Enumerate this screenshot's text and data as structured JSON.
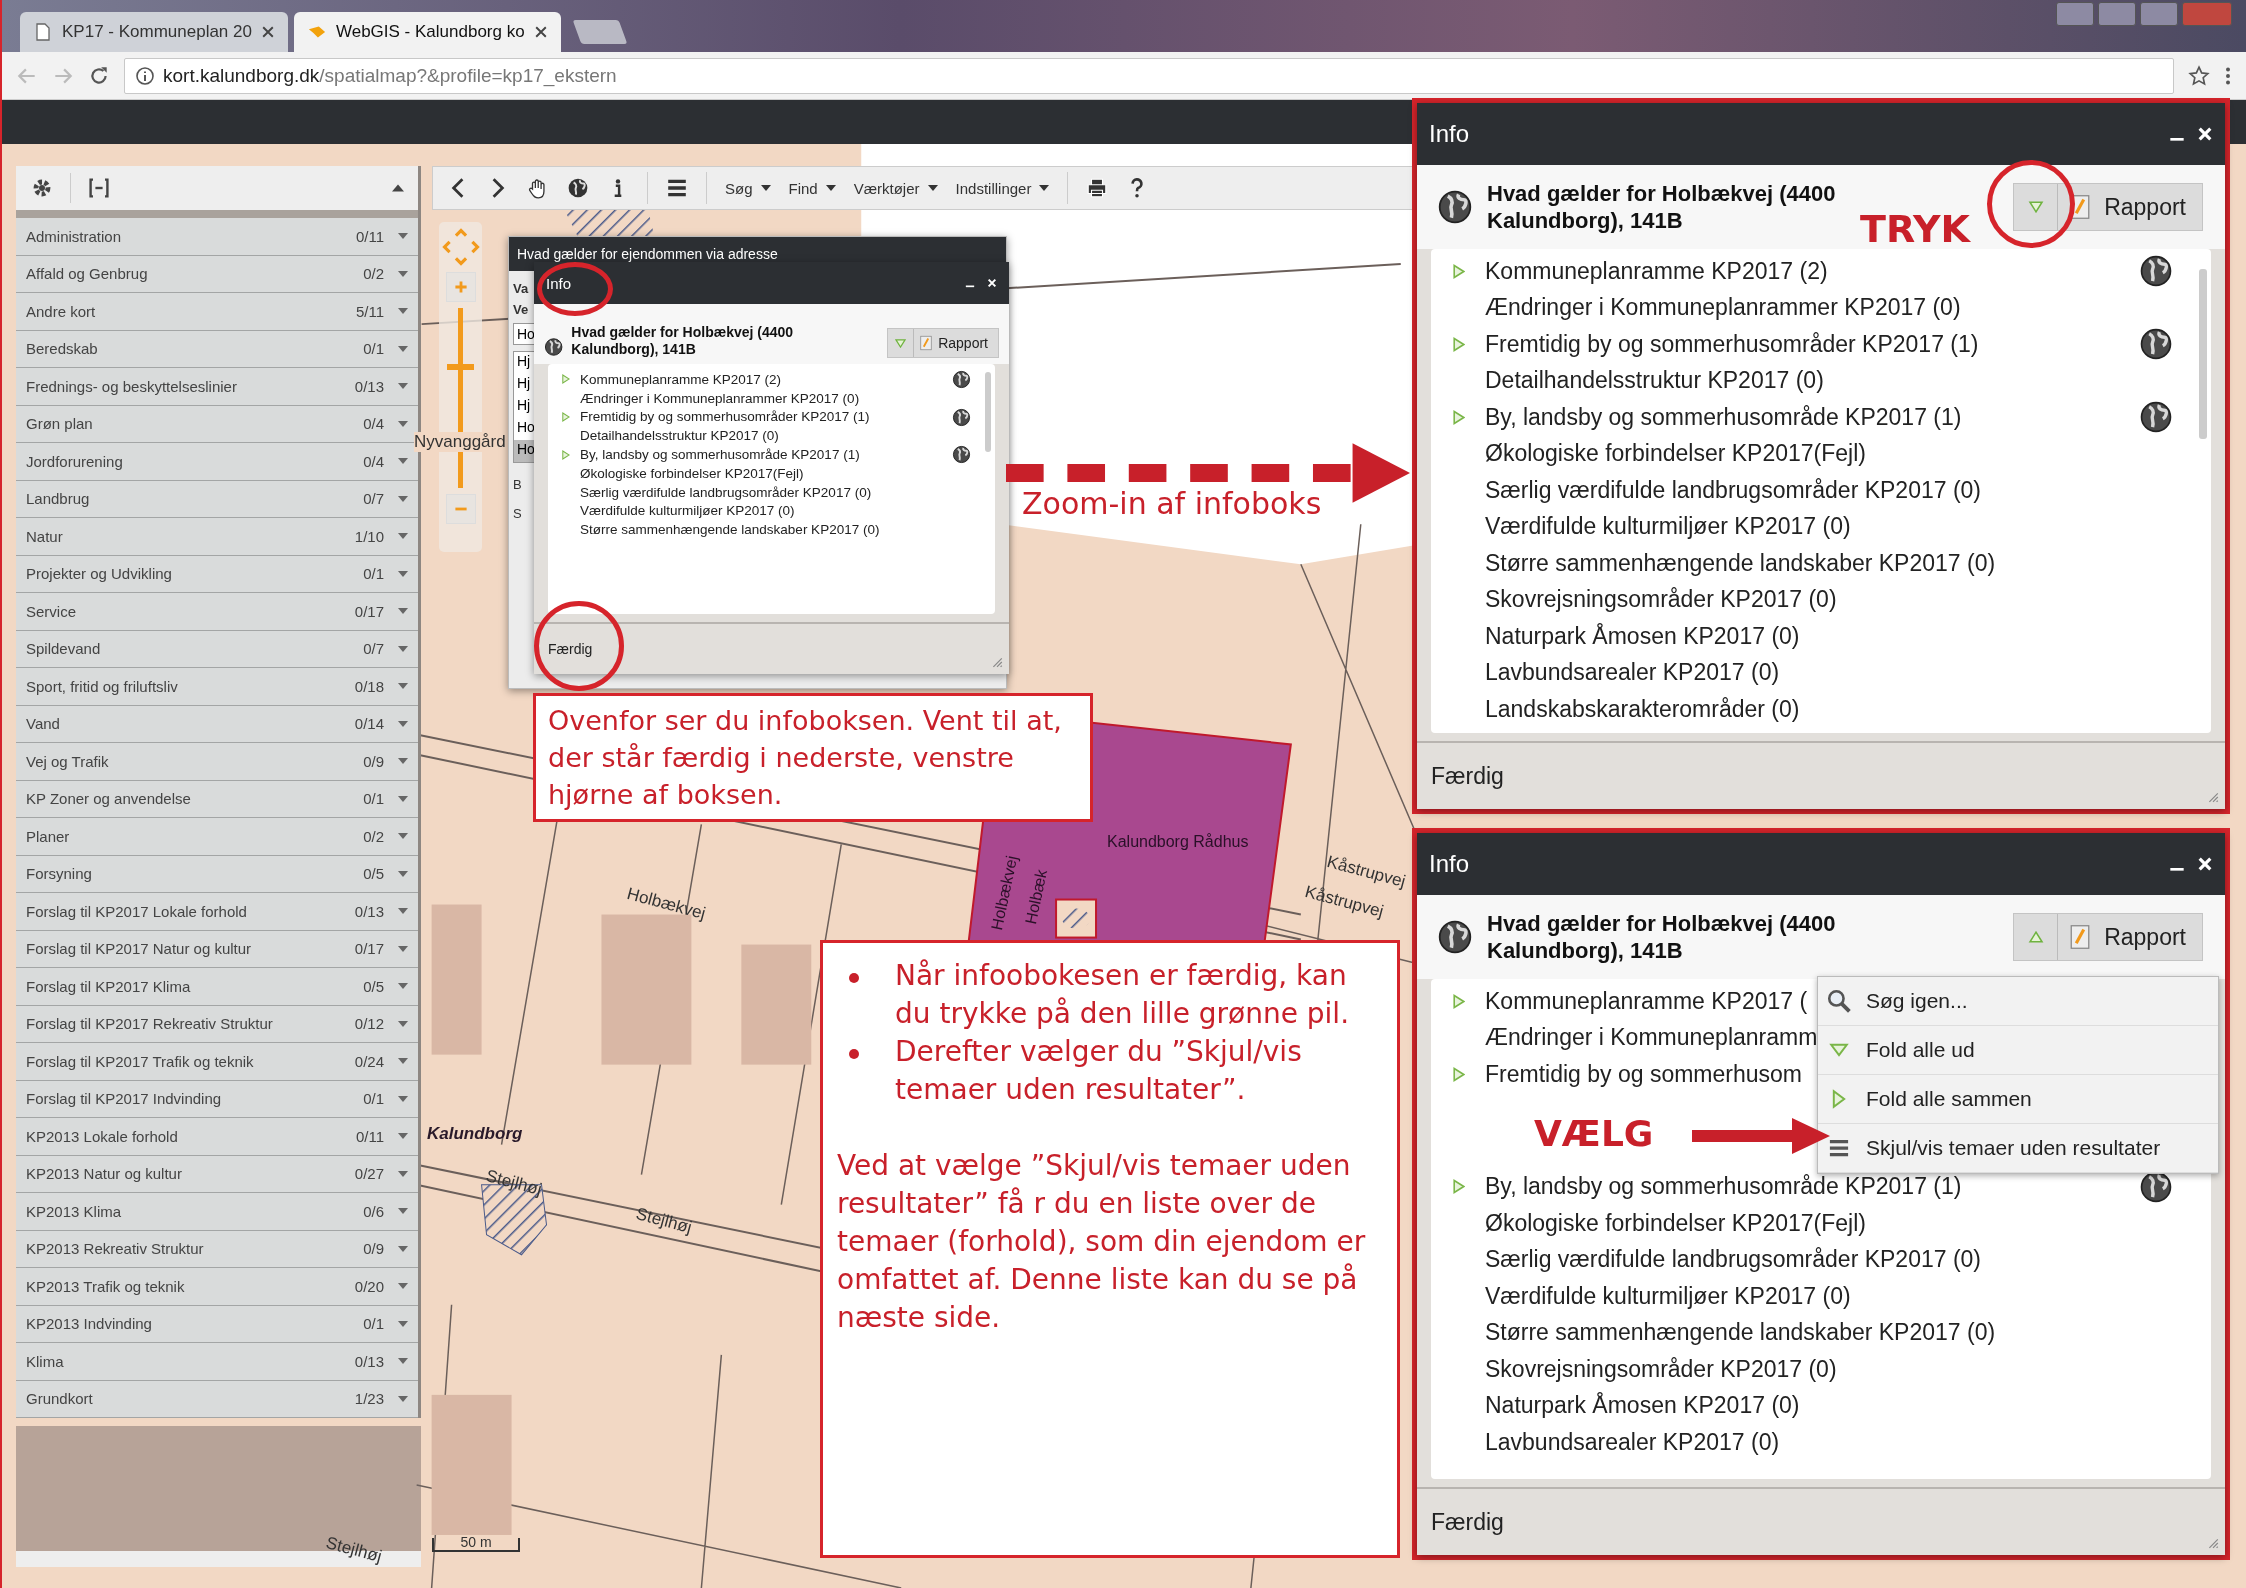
{
  "browser": {
    "tabs": [
      {
        "title": "KP17 - Kommuneplan 20",
        "selected": false,
        "kind": "document"
      },
      {
        "title": "WebGIS - Kalundborg ko",
        "selected": true,
        "kind": "webgis"
      }
    ],
    "url_host": "kort.kalundborg.dk",
    "url_path": "/spatialmap?&profile=kp17_ekstern"
  },
  "layers_panel": {
    "items": [
      {
        "name": "Administration",
        "count": "0/11"
      },
      {
        "name": "Affald og Genbrug",
        "count": "0/2"
      },
      {
        "name": "Andre kort",
        "count": "5/11"
      },
      {
        "name": "Beredskab",
        "count": "0/1"
      },
      {
        "name": "Frednings- og beskyttelseslinier",
        "count": "0/13"
      },
      {
        "name": "Grøn plan",
        "count": "0/4"
      },
      {
        "name": "Jordforurening",
        "count": "0/4"
      },
      {
        "name": "Landbrug",
        "count": "0/7"
      },
      {
        "name": "Natur",
        "count": "1/10"
      },
      {
        "name": "Projekter og Udvikling",
        "count": "0/1"
      },
      {
        "name": "Service",
        "count": "0/17"
      },
      {
        "name": "Spildevand",
        "count": "0/7"
      },
      {
        "name": "Sport, fritid og friluftsliv",
        "count": "0/18"
      },
      {
        "name": "Vand",
        "count": "0/14"
      },
      {
        "name": "Vej og Trafik",
        "count": "0/9"
      },
      {
        "name": "KP Zoner og anvendelse",
        "count": "0/1"
      },
      {
        "name": "Planer",
        "count": "0/2"
      },
      {
        "name": "Forsyning",
        "count": "0/5"
      },
      {
        "name": "Forslag til KP2017 Lokale forhold",
        "count": "0/13"
      },
      {
        "name": "Forslag til KP2017 Natur og kultur",
        "count": "0/17"
      },
      {
        "name": "Forslag til KP2017 Klima",
        "count": "0/5"
      },
      {
        "name": "Forslag til KP2017 Rekreativ Struktur",
        "count": "0/12"
      },
      {
        "name": "Forslag til KP2017 Trafik og teknik",
        "count": "0/24"
      },
      {
        "name": "Forslag til KP2017 Indvinding",
        "count": "0/1"
      },
      {
        "name": "KP2013 Lokale forhold",
        "count": "0/11"
      },
      {
        "name": "KP2013 Natur og kultur",
        "count": "0/27"
      },
      {
        "name": "KP2013 Klima",
        "count": "0/6"
      },
      {
        "name": "KP2013 Rekreativ Struktur",
        "count": "0/9"
      },
      {
        "name": "KP2013 Trafik og teknik",
        "count": "0/20"
      },
      {
        "name": "KP2013 Indvinding",
        "count": "0/1"
      },
      {
        "name": "Klima",
        "count": "0/13"
      },
      {
        "name": "Grundkort",
        "count": "1/23"
      }
    ]
  },
  "map_toolbar": {
    "menus": [
      "Søg",
      "Find",
      "Værktøjer",
      "Indstillinger"
    ]
  },
  "map_labels": [
    "Nyvanggård",
    "Kalundborg Rådhus",
    "Holbækvej",
    "Holbækvej",
    "Holbæk",
    "Kåstrupvej",
    "Kåstrupvej",
    "Kalundborg",
    "Stejlhøj",
    "Stejlhøj",
    "Stejlhøj"
  ],
  "scale_bar": "50 m",
  "zoom_slider": {
    "level": 0.68
  },
  "address_dialog": {
    "title": "Hvad gælder for ejendommen via adresse",
    "labels": [
      "Va",
      "Ve"
    ],
    "input_value": "Ho",
    "list": [
      {
        "text": "Hj",
        "selected": false
      },
      {
        "text": "Hj",
        "selected": false
      },
      {
        "text": "Hj",
        "selected": false
      },
      {
        "text": "Ho",
        "selected": false
      },
      {
        "text": "Ho",
        "selected": true
      }
    ],
    "lower_labels": [
      "B",
      "S"
    ]
  },
  "info_dialog": {
    "title": "Info",
    "heading": "Hvad gælder for Holbækvej (4400 Kalundborg), 141B",
    "menu_open": false,
    "report_button": "Rapport",
    "footer_button": "Færdig",
    "rows": [
      {
        "text": "Kommuneplanramme KP2017 (2)",
        "expandable": true,
        "globe": true
      },
      {
        "text": "Ændringer i Kommuneplanrammer KP2017 (0)",
        "expandable": false,
        "globe": false
      },
      {
        "text": "Fremtidig by og sommerhusområder KP2017 (1)",
        "expandable": true,
        "globe": true
      },
      {
        "text": "Detailhandelsstruktur KP2017 (0)",
        "expandable": false,
        "globe": false
      },
      {
        "text": "By, landsby og sommerhusområde KP2017 (1)",
        "expandable": true,
        "globe": true
      },
      {
        "text": "Økologiske forbindelser KP2017(Fejl)",
        "expandable": false,
        "globe": false
      },
      {
        "text": "Særlig værdifulde landbrugsområder KP2017 (0)",
        "expandable": false,
        "globe": false
      },
      {
        "text": "Værdifulde kulturmiljøer KP2017 (0)",
        "expandable": false,
        "globe": false
      },
      {
        "text": "Større sammenhængende landskaber KP2017 (0)",
        "expandable": false,
        "globe": false
      }
    ]
  },
  "zoomed_info_top": {
    "title": "Info",
    "heading": "Hvad gælder for Holbækvej (4400 Kalundborg), 141B",
    "menu_open": false,
    "report_button": "Rapport",
    "footer_button": "Færdig",
    "rows": [
      {
        "text": "Kommuneplanramme KP2017 (2)",
        "expandable": true,
        "globe": true
      },
      {
        "text": "Ændringer i Kommuneplanrammer KP2017 (0)",
        "expandable": false,
        "globe": false
      },
      {
        "text": "Fremtidig by og sommerhusområder KP2017 (1)",
        "expandable": true,
        "globe": true
      },
      {
        "text": "Detailhandelsstruktur KP2017 (0)",
        "expandable": false,
        "globe": false
      },
      {
        "text": "By, landsby og sommerhusområde KP2017 (1)",
        "expandable": true,
        "globe": true
      },
      {
        "text": "Økologiske forbindelser KP2017(Fejl)",
        "expandable": false,
        "globe": false
      },
      {
        "text": "Særlig værdifulde landbrugsområder KP2017 (0)",
        "expandable": false,
        "globe": false
      },
      {
        "text": "Værdifulde kulturmiljøer KP2017 (0)",
        "expandable": false,
        "globe": false
      },
      {
        "text": "Større sammenhængende landskaber KP2017 (0)",
        "expandable": false,
        "globe": false
      },
      {
        "text": "Skovrejsningsområder KP2017 (0)",
        "expandable": false,
        "globe": false
      },
      {
        "text": "Naturpark Åmosen KP2017 (0)",
        "expandable": false,
        "globe": false
      },
      {
        "text": "Lavbundsarealer KP2017 (0)",
        "expandable": false,
        "globe": false
      },
      {
        "text": "Landskabskarakterområder (0)",
        "expandable": false,
        "globe": false
      }
    ]
  },
  "zoomed_info_bottom": {
    "title": "Info",
    "heading": "Hvad gælder for Holbækvej (4400 Kalundborg), 141B",
    "menu_open": true,
    "report_button": "Rapport",
    "footer_button": "Færdig",
    "rows": [
      {
        "text": "Kommuneplanramme KP2017 (",
        "expandable": true,
        "globe": false
      },
      {
        "text": "Ændringer i Kommuneplanramm",
        "expandable": false,
        "globe": false
      },
      {
        "text": "Fremtidig by og sommerhusom",
        "expandable": true,
        "globe": false
      },
      {
        "text": "By, landsby og sommerhusområde KP2017 (1)",
        "expandable": true,
        "globe": true
      },
      {
        "text": "Økologiske forbindelser KP2017(Fejl)",
        "expandable": false,
        "globe": false
      },
      {
        "text": "Særlig værdifulde landbrugsområder KP2017 (0)",
        "expandable": false,
        "globe": false
      },
      {
        "text": "Værdifulde kulturmiljøer KP2017 (0)",
        "expandable": false,
        "globe": false
      },
      {
        "text": "Større sammenhængende landskaber KP2017 (0)",
        "expandable": false,
        "globe": false
      },
      {
        "text": "Skovrejsningsområder KP2017 (0)",
        "expandable": false,
        "globe": false
      },
      {
        "text": "Naturpark Åmosen KP2017 (0)",
        "expandable": false,
        "globe": false
      },
      {
        "text": "Lavbundsarealer KP2017 (0)",
        "expandable": false,
        "globe": false
      }
    ],
    "menu": [
      {
        "label": "Søg igen...",
        "kind": "search"
      },
      {
        "label": "Fold alle ud",
        "kind": "expand"
      },
      {
        "label": "Fold alle sammen",
        "kind": "collapse"
      },
      {
        "label": "Skjul/vis temaer uden resultater",
        "kind": "list"
      }
    ]
  },
  "annotations": {
    "zoom_label": "Zoom-in af infoboks",
    "press_label": "TRYK",
    "choose_label": "VÆLG",
    "note_top": "Ovenfor ser du infoboksen. Vent til at, der står færdig i nederste, venstre hjørne af boksen.",
    "note_bullets": [
      "Når infoobokesen er færdig, kan du trykke på den lille grønne pil.",
      "Derefter vælger du ”Skjul/vis temaer uden resultater”."
    ],
    "note_paragraph": "Ved at vælge ”Skjul/vis temaer uden resultater” få r du en liste over de temaer (forhold), som din ejendom er omfattet af. Denne liste kan du se på næste side."
  }
}
